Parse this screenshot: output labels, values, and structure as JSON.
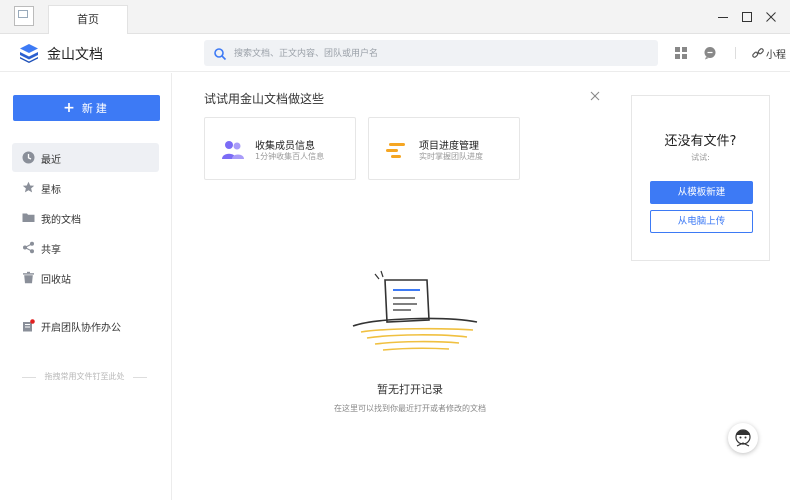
{
  "titlebar": {
    "tab_label": "首页",
    "window_controls": [
      "minimize-icon",
      "maximize-icon",
      "close-icon"
    ]
  },
  "header": {
    "brand": "金山文档",
    "search_placeholder": "搜索文档、正文内容、团队或用户名",
    "user_label": "小程"
  },
  "sidebar": {
    "new_button": "新建",
    "items": [
      {
        "label": "最近",
        "icon": "clock-icon",
        "active": true
      },
      {
        "label": "星标",
        "icon": "star-icon",
        "active": false
      },
      {
        "label": "我的文档",
        "icon": "folder-icon",
        "active": false
      },
      {
        "label": "共享",
        "icon": "share-icon",
        "active": false
      },
      {
        "label": "回收站",
        "icon": "trash-icon",
        "active": false
      },
      {
        "label": "开启团队协作办公",
        "icon": "team-icon",
        "active": false
      }
    ],
    "drop_hint": "拖拽常用文件钉至此处"
  },
  "try_section": {
    "title": "试试用金山文档做这些",
    "cards": [
      {
        "title": "收集成员信息",
        "subtitle": "1分钟收集百人信息",
        "icon": "members-icon"
      },
      {
        "title": "项目进度管理",
        "subtitle": "实时掌握团队进度",
        "icon": "progress-icon"
      }
    ]
  },
  "empty_state": {
    "title": "暂无打开记录",
    "subtitle": "在这里可以找到你最近打开或者修改的文档"
  },
  "side_panel": {
    "title": "还没有文件?",
    "subtitle": "试试:",
    "primary_button": "从模板新建",
    "secondary_button": "从电脑上传"
  },
  "colors": {
    "accent": "#3d7af5",
    "sidebar_active": "#eef0f4"
  }
}
